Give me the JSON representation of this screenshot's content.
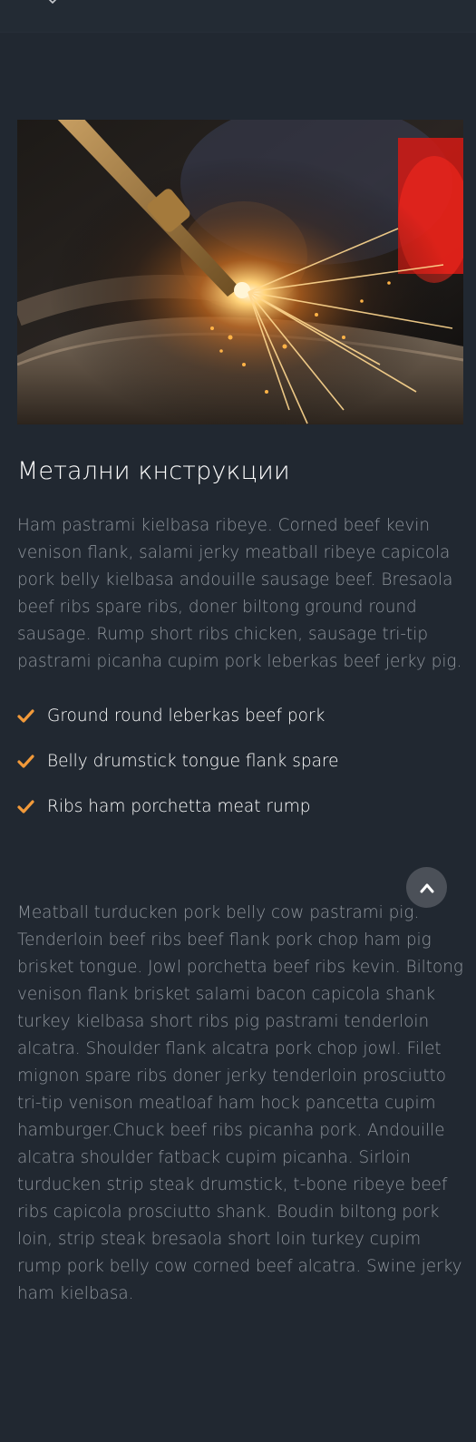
{
  "colors": {
    "background": "#212831",
    "accent": "#f29a3a",
    "heading": "#ffffff",
    "text": "#8f959c",
    "scroll_button": "#4b5058"
  },
  "header": {
    "icon": "chevron-down-icon"
  },
  "hero": {
    "image_subject": "welding torch cutting metal with sparks"
  },
  "section": {
    "title": "Метални кнструкции",
    "lead": "Ham pastrami kielbasa ribeye. Corned beef kevin venison flank, salami jerky meatball ribeye capicola pork belly kielbasa andouille sausage beef. Bresaola beef ribs spare ribs, doner biltong ground round sausage. Rump short ribs chicken, sausage tri-tip pastrami picanha cupim pork leberkas beef jerky pig.",
    "checklist": [
      "Ground round leberkas beef pork",
      "Belly drumstick tongue flank spare",
      "Ribs ham porchetta meat rump"
    ],
    "body": "Meatball turducken pork belly cow pastrami pig. Tenderloin beef ribs beef flank pork chop ham pig brisket tongue. Jowl porchetta beef ribs kevin. Biltong venison flank brisket salami bacon capicola shank turkey kielbasa short ribs pig pastrami tenderloin alcatra. Shoulder flank alcatra pork chop jowl. Filet mignon spare ribs doner jerky tenderloin prosciutto tri-tip venison meatloaf ham hock pancetta cupim hamburger.Chuck beef ribs picanha pork. Andouille alcatra shoulder fatback cupim picanha. Sirloin turducken strip steak drumstick, t-bone ribeye beef ribs capicola prosciutto shank. Boudin biltong pork loin, strip steak bresaola short loin turkey cupim rump pork belly cow corned beef alcatra. Swine jerky ham kielbasa."
  },
  "scroll_top": {
    "icon": "chevron-up-icon"
  }
}
